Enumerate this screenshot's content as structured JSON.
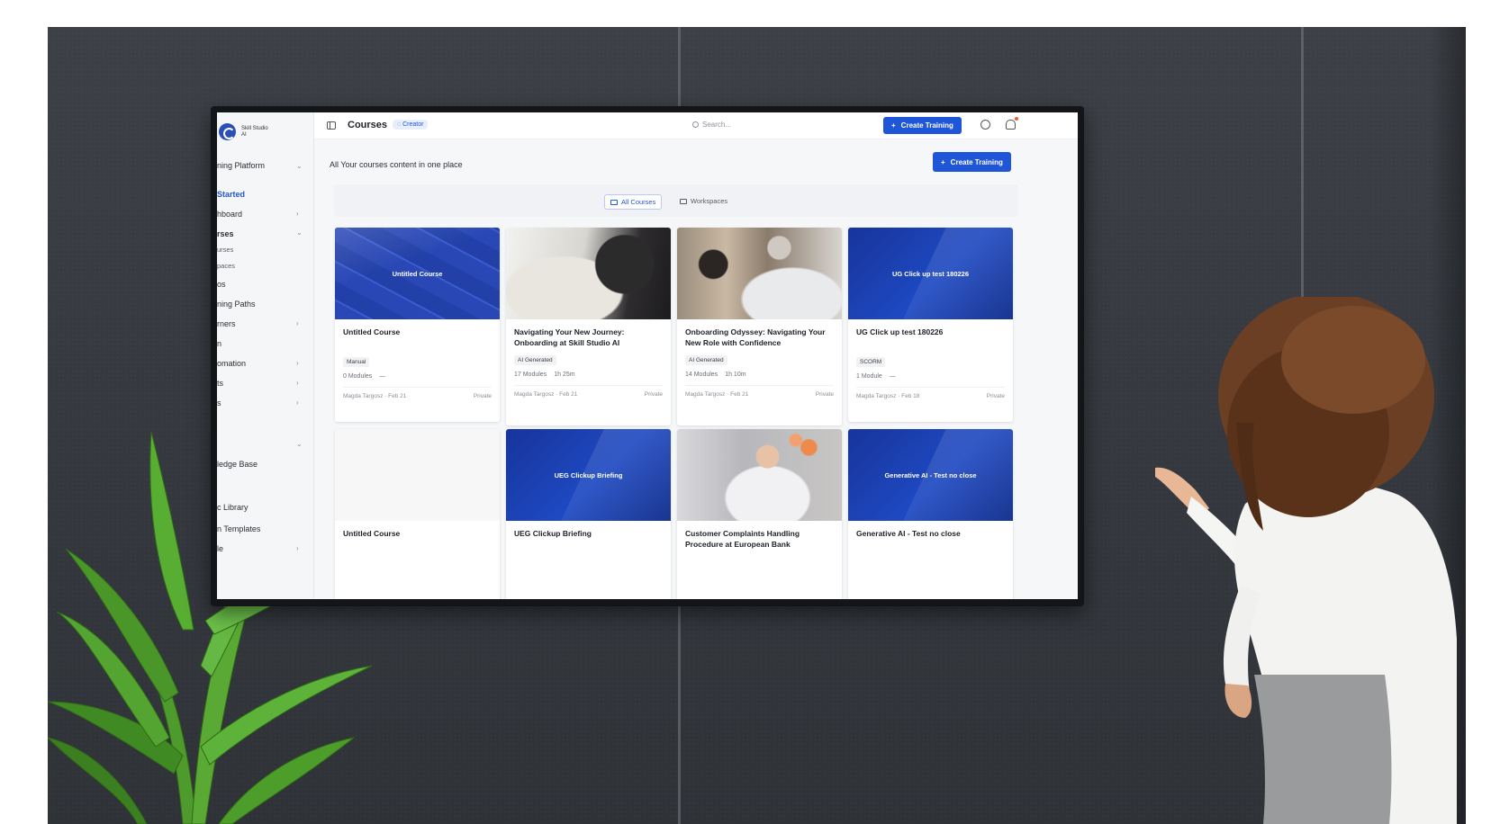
{
  "app": {
    "logo_text": "Skill Studio AI",
    "sidebar": {
      "workspace": "ning Platform",
      "items": [
        {
          "label": "Started",
          "active": true
        },
        {
          "label": "hboard"
        },
        {
          "label": "rses"
        },
        {
          "label": "urses",
          "small": true
        },
        {
          "label": "paces",
          "small": true
        },
        {
          "label": "os"
        },
        {
          "label": "ning Paths"
        },
        {
          "label": "rners"
        },
        {
          "label": "n"
        },
        {
          "label": "omation"
        },
        {
          "label": "ts"
        },
        {
          "label": "s"
        },
        {
          "label": "ledge Base"
        },
        {
          "label": "c Library"
        },
        {
          "label": "n Templates"
        },
        {
          "label": "le"
        }
      ]
    },
    "topbar": {
      "title": "Courses",
      "badge": "Creator",
      "search_placeholder": "Search...",
      "create_button": "Create Training"
    },
    "content": {
      "subtitle": "All Your courses content in one place",
      "create_button": "Create Training",
      "tabs": {
        "all": "All Courses",
        "workspaces": "Workspaces"
      }
    },
    "cards": [
      {
        "title": "Untitled Course",
        "thumb_label": "Untitled Course",
        "tag": "Manual",
        "modules": "0 Modules",
        "duration": "—",
        "author": "Magda Targosz",
        "date": "Feb 21",
        "visibility": "Private"
      },
      {
        "title": "Navigating Your New Journey: Onboarding at Skill Studio AI",
        "thumb_label": "",
        "tag": "AI Generated",
        "modules": "17 Modules",
        "duration": "1h 25m",
        "author": "Magda Targosz",
        "date": "Feb 21",
        "visibility": "Private"
      },
      {
        "title": "Onboarding Odyssey: Navigating Your New Role with Confidence",
        "thumb_label": "",
        "tag": "AI Generated",
        "modules": "14 Modules",
        "duration": "1h 10m",
        "author": "Magda Targosz",
        "date": "Feb 21",
        "visibility": "Private"
      },
      {
        "title": "UG Click up test 180226",
        "thumb_label": "UG Click up test 180226",
        "tag": "SCORM",
        "modules": "1 Module",
        "duration": "—",
        "author": "Magda Targosz",
        "date": "Feb 18",
        "visibility": "Private"
      },
      {
        "title": "Untitled Course",
        "thumb_label": ""
      },
      {
        "title": "UEG Clickup Briefing",
        "thumb_label": "UEG Clickup Briefing"
      },
      {
        "title": "Customer Complaints Handling Procedure at European Bank",
        "thumb_label": ""
      },
      {
        "title": "Generative AI - Test no close",
        "thumb_label": "Generative AI - Test no close"
      }
    ]
  },
  "colors": {
    "accent": "#1f56d8",
    "wall": "#3a3d43",
    "plant": "#4f9a2c"
  }
}
